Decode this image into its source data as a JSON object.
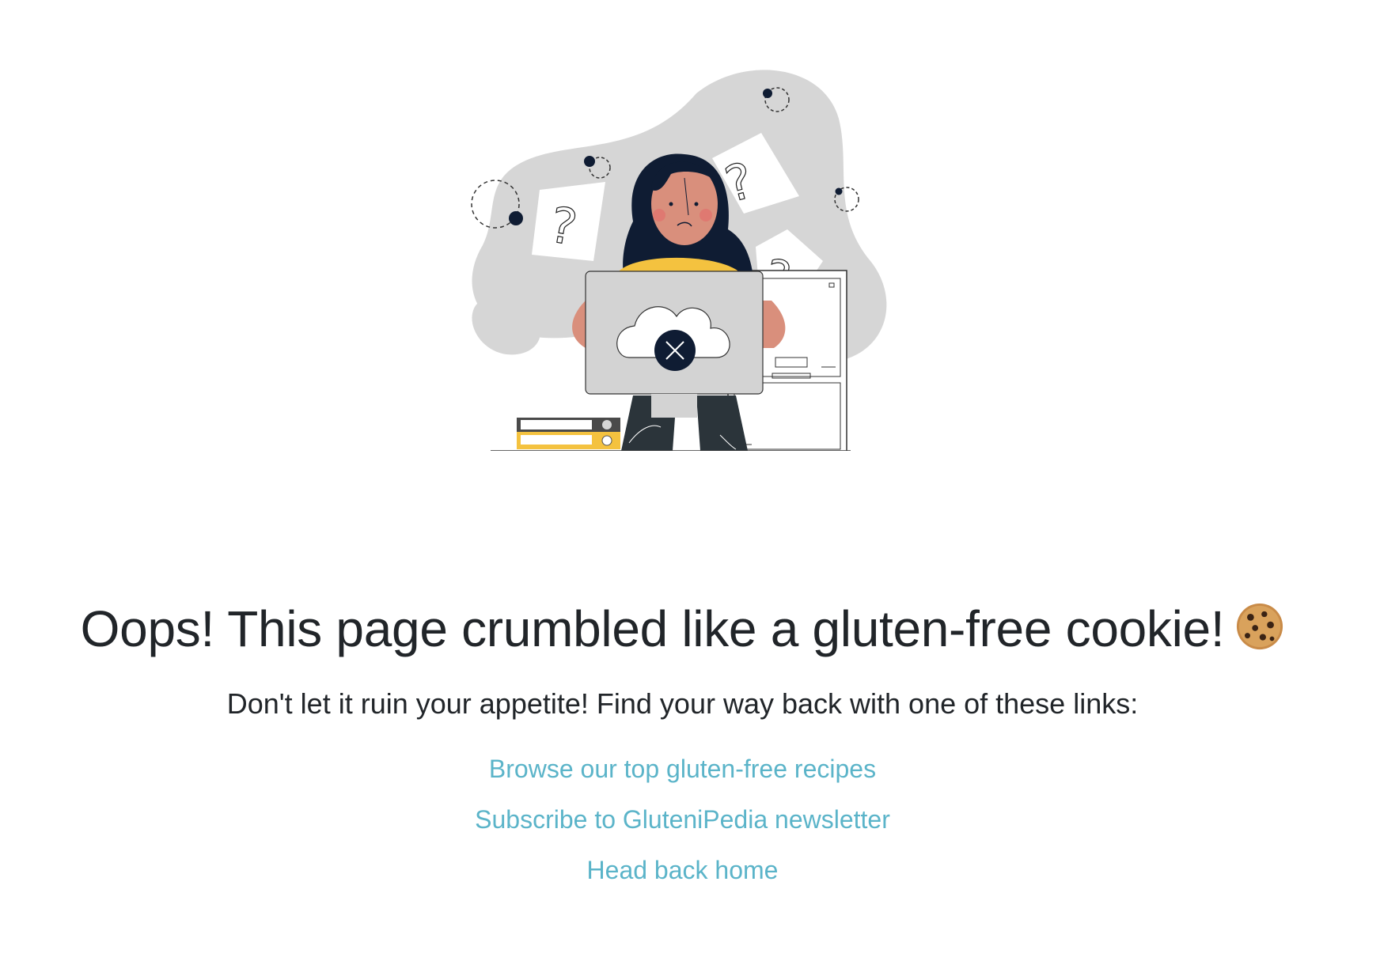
{
  "error_page": {
    "illustration_name": "confused-woman-with-laptop-error",
    "heading": "Oops! This page crumbled like a gluten-free cookie!",
    "heading_emoji": "cookie",
    "subtitle": "Don't let it ruin your appetite! Find your way back with one of these links:",
    "links": [
      {
        "label": "Browse our top gluten-free recipes"
      },
      {
        "label": "Subscribe to GluteniPedia newsletter"
      },
      {
        "label": "Head back home"
      }
    ]
  },
  "colors": {
    "text": "#212529",
    "link": "#5bb4c9",
    "blob": "#d9d9d9",
    "navy": "#0f1c33",
    "yellow": "#f4c23f",
    "skin": "#d98f7c"
  }
}
